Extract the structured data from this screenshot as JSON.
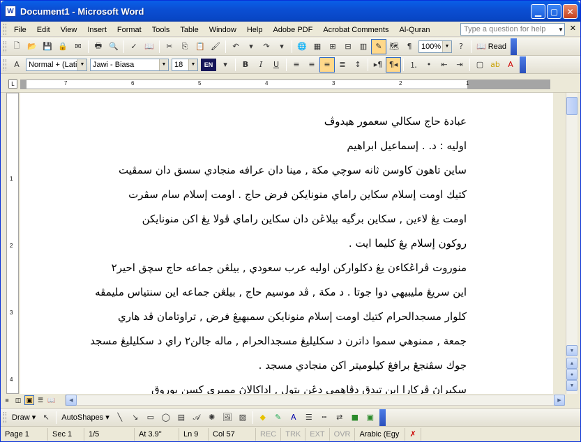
{
  "window": {
    "title": "Document1 - Microsoft Word",
    "icon_text": "W"
  },
  "menu": {
    "items": [
      "File",
      "Edit",
      "View",
      "Insert",
      "Format",
      "Tools",
      "Table",
      "Window",
      "Help",
      "Adobe PDF",
      "Acrobat Comments",
      "Al-Quran"
    ],
    "help_placeholder": "Type a question for help"
  },
  "toolbar": {
    "zoom": "100%",
    "read_label": "Read",
    "style": "Normal + (Latin",
    "font": "Jawi - Biasa",
    "size": "18",
    "lang": "EN"
  },
  "ruler": {
    "numbers": [
      "7",
      "6",
      "5",
      "4",
      "3",
      "2",
      "1"
    ]
  },
  "vruler": {
    "numbers": [
      "1",
      "2",
      "3",
      "4"
    ]
  },
  "document": {
    "paragraphs": [
      {
        "lines": [
          "عبادة حاج سكالي سعمور هيدوڤ"
        ]
      },
      {
        "lines": [
          "اوليه : د. . إسماعيل ابراهيم"
        ]
      },
      {
        "lines": [
          "ساين تاهون كاوسن ثانه سوچي مكة , مينا دان عرافه منجادي سسق دان سمڤيت",
          "كتيك اومت إسلام سکاين راماي منونايكن فرض حاج . اومت إسلام سام سڤرت",
          "اومت يڠ لاءين , سکاين برگيه بيلاڠن دان سکاين راماي ڤولا يڠ اكن منونايكن",
          "روكون إسلام يڠ كليما ايت ."
        ]
      },
      {
        "lines": [
          "منوروت ڤراڠكاءن يڠ دكلواركن اوليه عرب سعودي , بيلڠن جماعه حاج سچق احير٢",
          "اين سريڠ مليبيهي دوا جوتا . د مكة , ڤد موسيم حاج , بيلڠن جماعه اين سنتياس مليمڤه",
          "كلوار مسجدالحرام كتيك اومت إسلام منونايكن سمبهيڠ فرض , تراوتامان ڤد هاري",
          "جمعة , ممنوهي سموا داترن د سكليليڠ مسجدالحرام , ماله جالن٢ راي د سكليليڠ مسجد",
          "جوك سڤنجڠ برافڠ كيلوميتر اكن منجادي مسجد ."
        ]
      },
      {
        "lines": [
          "سكيراڽ ڤركارا اين تيدق دڤاهمي دڠن بتول , اداكالاڽ ممبري كسن بوروق"
        ]
      }
    ]
  },
  "drawbar": {
    "draw_label": "Draw",
    "autoshapes_label": "AutoShapes"
  },
  "status": {
    "page": "Page 1",
    "sec": "Sec 1",
    "pages": "1/5",
    "at": "At 3.9\"",
    "ln": "Ln 9",
    "col": "Col 57",
    "rec": "REC",
    "trk": "TRK",
    "ext": "EXT",
    "ovr": "OVR",
    "lang": "Arabic (Egy"
  }
}
